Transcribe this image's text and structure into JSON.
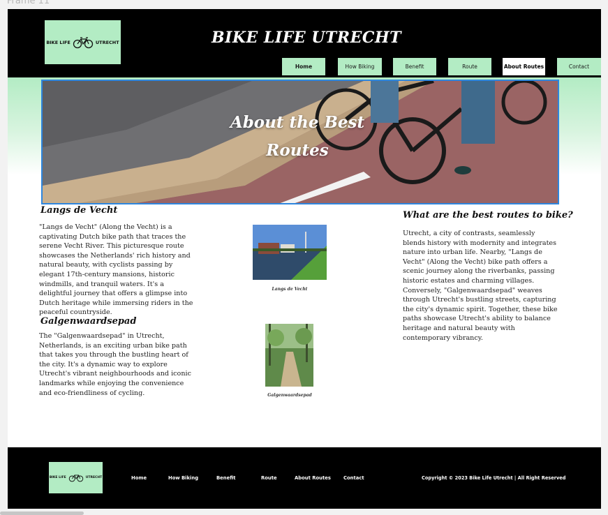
{
  "frame_label": "Frame 11",
  "header": {
    "logo": {
      "left": "BIKE LIFE",
      "right": "UTRECHT",
      "icon": "bicycle-icon"
    },
    "title": "BIKE LIFE UTRECHT",
    "nav": [
      {
        "label": "Home",
        "active": false
      },
      {
        "label": "How Biking",
        "active": false
      },
      {
        "label": "Benefit",
        "active": false
      },
      {
        "label": "Route",
        "active": false
      },
      {
        "label": "About Routes",
        "active": true
      },
      {
        "label": "Contact",
        "active": false
      }
    ]
  },
  "hero": {
    "title_line1": "About the Best",
    "title_line2": "Routes"
  },
  "routes": [
    {
      "heading": "Langs de Vecht",
      "text": "\"Langs de Vecht\" (Along the Vecht) is a captivating Dutch bike path that traces the serene Vecht River. This picturesque route showcases the Netherlands' rich history and natural beauty, with cyclists passing by elegant 17th-century mansions, historic windmills, and tranquil waters. It's a delightful journey that offers a glimpse into Dutch heritage while immersing riders in the peaceful countryside.",
      "caption": "Langs de Vecht"
    },
    {
      "heading": "Galgenwaardsepad",
      "text": "The \"Galgenwaardsepad\" in Utrecht, Netherlands, is an exciting urban bike path that takes you through the bustling heart of the city. It's a dynamic way to explore Utrecht's vibrant neighbourhoods and iconic landmarks while enjoying the convenience and eco-friendliness of cycling.",
      "caption": "Galgenwaardsepad"
    }
  ],
  "best_routes": {
    "heading": "What are the best routes to bike?",
    "text": "Utrecht, a city of contrasts, seamlessly blends history with modernity and integrates nature into urban life. Nearby, \"Langs de Vecht\" (Along the Vecht) bike path offers a scenic journey along the riverbanks, passing historic estates and charming villages. Conversely, \"Galgenwaardsepad\" weaves through Utrecht's bustling streets, capturing the city's dynamic spirit. Together, these bike paths showcase Utrecht's ability to balance heritage and natural beauty with contemporary vibrancy."
  },
  "footer": {
    "nav": [
      "Home",
      "How Biking",
      "Benefit",
      "Route",
      "About Routes",
      "Contact"
    ],
    "copyright": "Copyright  © 2023 Bike Life Utrecht | All Right Reserved"
  },
  "colors": {
    "mint": "#b3ecc4",
    "black": "#000000",
    "hero_border": "#2e86de"
  }
}
